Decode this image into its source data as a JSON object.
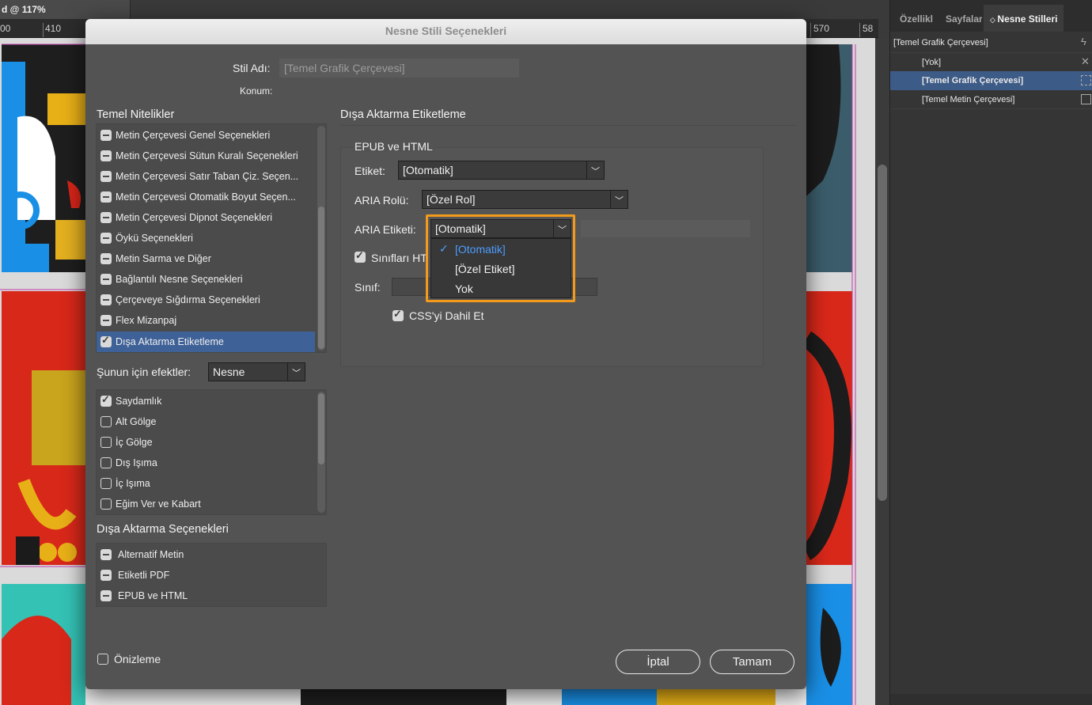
{
  "app": {
    "doc_tab": "d @ 117%",
    "ruler_labels": [
      "00",
      "410",
      "570",
      "58"
    ]
  },
  "panel": {
    "tabs": [
      "Özellikl",
      "Sayfalar",
      "Nesne Stilleri"
    ],
    "current_style": "[Temel Grafik Çerçevesi]",
    "items": [
      {
        "label": "[Yok]",
        "icon": "cross-icon"
      },
      {
        "label": "[Temel Grafik Çerçevesi]",
        "icon": "graphic-frame-icon",
        "selected": true
      },
      {
        "label": "[Temel Metin Çerçevesi]",
        "icon": "text-frame-icon"
      }
    ]
  },
  "dialog": {
    "title": "Nesne Stili Seçenekleri",
    "style_name_label": "Stil Adı:",
    "style_name_value": "[Temel Grafik Çerçevesi]",
    "location_label": "Konum:",
    "basic_attributes_heading": "Temel Nitelikler",
    "basic_attributes": [
      {
        "label": "Metin Çerçevesi Genel Seçenekleri",
        "state": "minus"
      },
      {
        "label": "Metin Çerçevesi Sütun Kuralı Seçenekleri",
        "state": "minus"
      },
      {
        "label": "Metin Çerçevesi Satır Taban Çiz. Seçen...",
        "state": "minus"
      },
      {
        "label": "Metin Çerçevesi Otomatik Boyut Seçen...",
        "state": "minus"
      },
      {
        "label": "Metin Çerçevesi Dipnot Seçenekleri",
        "state": "minus"
      },
      {
        "label": "Öykü Seçenekleri",
        "state": "minus"
      },
      {
        "label": "Metin Sarma ve Diğer",
        "state": "minus"
      },
      {
        "label": "Bağlantılı Nesne Seçenekleri",
        "state": "minus"
      },
      {
        "label": "Çerçeveye Sığdırma Seçenekleri",
        "state": "minus"
      },
      {
        "label": "Flex Mizanpaj",
        "state": "minus"
      },
      {
        "label": "Dışa Aktarma Etiketleme",
        "state": "check",
        "selected": true
      }
    ],
    "effects_for_label": "Şunun için efektler:",
    "effects_for_value": "Nesne",
    "effects": [
      {
        "label": "Saydamlık",
        "state": "check"
      },
      {
        "label": "Alt Gölge",
        "state": "empty"
      },
      {
        "label": "İç Gölge",
        "state": "empty"
      },
      {
        "label": "Dış Işıma",
        "state": "empty"
      },
      {
        "label": "İç Işıma",
        "state": "empty"
      },
      {
        "label": "Eğim Ver ve Kabart",
        "state": "empty"
      }
    ],
    "export_options_heading": "Dışa Aktarma Seçenekleri",
    "export_options": [
      {
        "label": "Alternatif Metin",
        "state": "minus"
      },
      {
        "label": "Etiketli PDF",
        "state": "minus"
      },
      {
        "label": "EPUB ve HTML",
        "state": "minus"
      }
    ],
    "section_heading": "Dışa Aktarma Etiketleme",
    "epub_group_title": "EPUB ve HTML",
    "tag_label": "Etiket:",
    "tag_value": "[Otomatik]",
    "aria_role_label": "ARIA Rolü:",
    "aria_role_value": "[Özel Rol]",
    "aria_label_label": "ARIA Etiketi:",
    "aria_label_value": "[Otomatik]",
    "aria_label_options": [
      {
        "label": "[Otomatik]",
        "selected": true
      },
      {
        "label": "[Özel Etiket]",
        "selected": false
      },
      {
        "label": "Yok",
        "selected": false
      }
    ],
    "classes_checkbox_label": "Sınıfları HT",
    "class_label": "Sınıf:",
    "include_css_label": "CSS'yi Dahil Et",
    "preview_label": "Önizleme",
    "cancel_label": "İptal",
    "ok_label": "Tamam",
    "highlight_color": "#f39a1b",
    "selection_color": "#3e6197"
  }
}
